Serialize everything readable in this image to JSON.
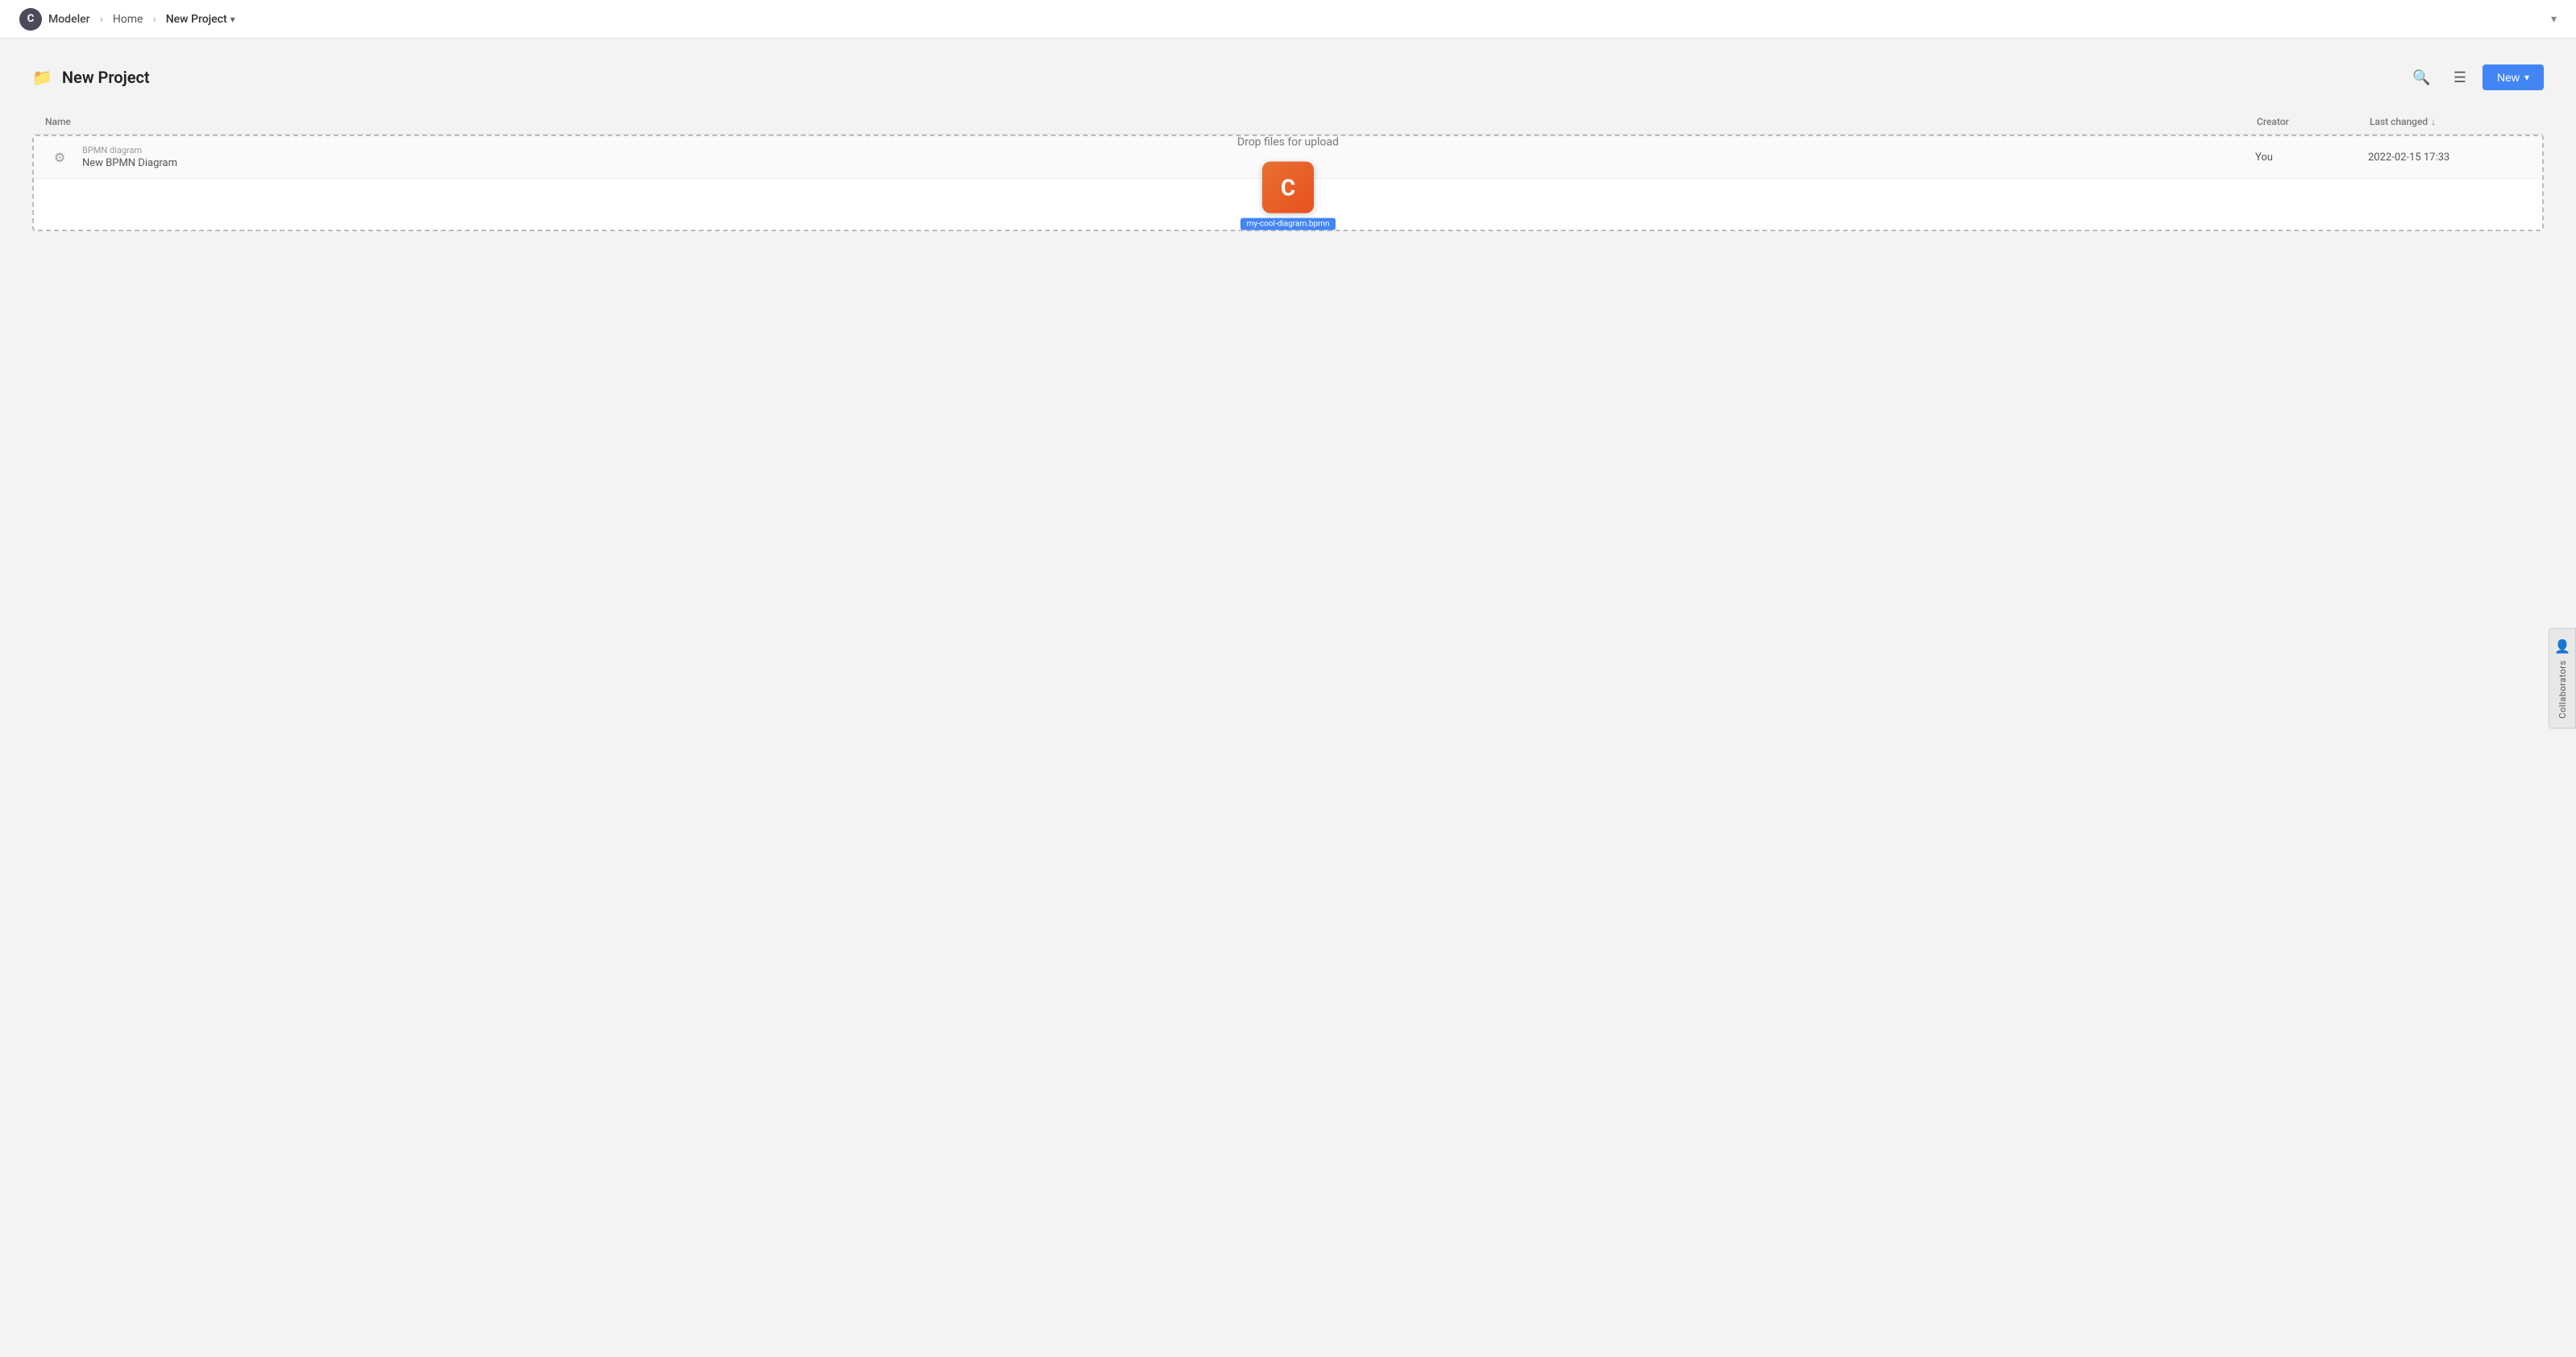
{
  "app": {
    "logo_text": "C",
    "name": "Modeler"
  },
  "breadcrumb": {
    "home": "Home",
    "separator": "›",
    "current": "New Project",
    "chevron": "▾"
  },
  "navbar": {
    "chevron": "▾"
  },
  "page": {
    "title": "New Project",
    "folder_icon": "📁"
  },
  "toolbar": {
    "search_tooltip": "Search",
    "filter_tooltip": "Filter",
    "new_label": "New",
    "new_chevron": "▾"
  },
  "table": {
    "col_name": "Name",
    "col_creator": "Creator",
    "col_changed": "Last changed",
    "sort_icon": "↓"
  },
  "rows": [
    {
      "type": "BPMN diagram",
      "name": "New BPMN Diagram",
      "creator": "You",
      "changed": "2022-02-15 17:33"
    }
  ],
  "drop_zone": {
    "text": "Drop files for upload"
  },
  "dragged_file": {
    "icon_letter": "C",
    "name": "my-cool-diagram.bpmn",
    "badge_color": "#4285f4"
  },
  "collaborators": {
    "label": "Collaborators",
    "person_icon": "👤"
  }
}
